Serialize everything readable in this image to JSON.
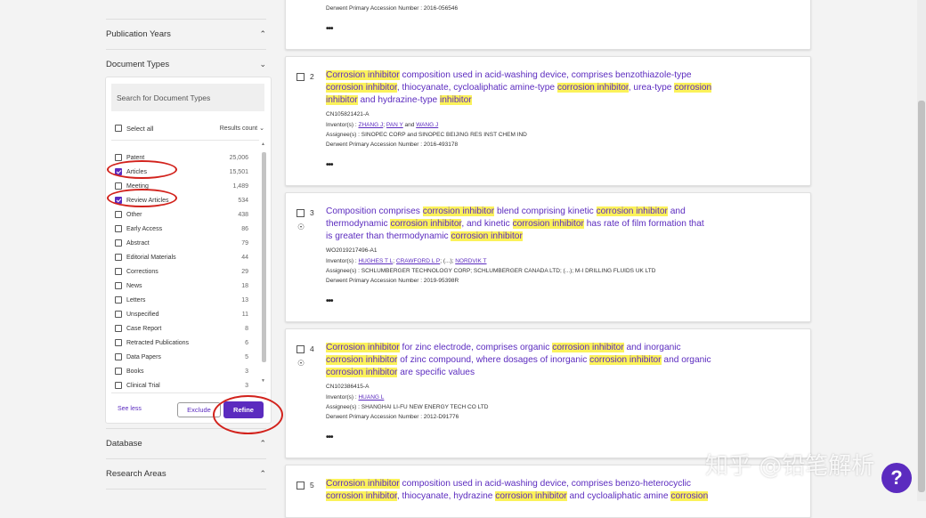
{
  "sidebar": {
    "publication_years": "Publication Years",
    "document_types": "Document Types",
    "database": "Database",
    "research_areas": "Research Areas",
    "search_placeholder": "Search for Document Types",
    "select_all": "Select all",
    "results_count": "Results count",
    "items": [
      {
        "label": "Patent",
        "count": "25,006",
        "checked": false
      },
      {
        "label": "Articles",
        "count": "15,501",
        "checked": true
      },
      {
        "label": "Meeting",
        "count": "1,489",
        "checked": false
      },
      {
        "label": "Review Articles",
        "count": "534",
        "checked": true
      },
      {
        "label": "Other",
        "count": "438",
        "checked": false
      },
      {
        "label": "Early Access",
        "count": "86",
        "checked": false
      },
      {
        "label": "Abstract",
        "count": "79",
        "checked": false
      },
      {
        "label": "Editorial Materials",
        "count": "44",
        "checked": false
      },
      {
        "label": "Corrections",
        "count": "29",
        "checked": false
      },
      {
        "label": "News",
        "count": "18",
        "checked": false
      },
      {
        "label": "Letters",
        "count": "13",
        "checked": false
      },
      {
        "label": "Unspecified",
        "count": "11",
        "checked": false
      },
      {
        "label": "Case Report",
        "count": "8",
        "checked": false
      },
      {
        "label": "Retracted Publications",
        "count": "6",
        "checked": false
      },
      {
        "label": "Data Papers",
        "count": "5",
        "checked": false
      },
      {
        "label": "Books",
        "count": "3",
        "checked": false
      },
      {
        "label": "Clinical Trial",
        "count": "3",
        "checked": false
      }
    ],
    "see_less": "See less",
    "exclude": "Exclude",
    "refine": "Refine"
  },
  "records": {
    "prev_accession": "Derwent Primary Accession Number : 2016-056546",
    "more": "•••",
    "r2": {
      "num": "2",
      "id": "CN105821421-A",
      "inventors_label": "Inventor(s) : ",
      "inventor_a": "ZHANG J",
      "inventor_b": "PAN Y",
      "inventor_and": " and ",
      "inventor_c": "WANG J",
      "assignee": "Assignee(s) : SINOPEC CORP and SINOPEC BEIJING RES INST CHEM IND",
      "accession": "Derwent Primary Accession Number : 2016-493178"
    },
    "r3": {
      "num": "3",
      "id": "WO2019217496-A1",
      "inventors_label": "Inventor(s) : ",
      "inventor_a": "HUGHES T L",
      "inventor_b": "CRAWFORD L P",
      "inventor_etc": " (...); ",
      "inventor_c": "NORDVIK T",
      "assignee": "Assignee(s) : SCHLUMBERGER TECHNOLOGY CORP; SCHLUMBERGER CANADA LTD; (...); M-I DRILLING FLUIDS UK LTD",
      "accession": "Derwent Primary Accession Number : 2019-95398R"
    },
    "r4": {
      "num": "4",
      "id": "CN102386415-A",
      "inventors_label": "Inventor(s) : ",
      "inventor_a": "HUANG L",
      "assignee": "Assignee(s) : SHANGHAI LI-FU NEW ENERGY TECH CO LTD",
      "accession": "Derwent Primary Accession Number : 2012-D91776"
    },
    "r5": {
      "num": "5"
    },
    "titles": {
      "t2": [
        [
          "Corrosion inhibitor",
          true
        ],
        [
          " composition used in acid-washing device, comprises benzothiazole-type",
          false
        ],
        [
          "\n",
          false
        ],
        [
          "corrosion inhibitor",
          true
        ],
        [
          ", thiocyanate, cycloaliphatic amine-type ",
          false
        ],
        [
          "corrosion inhibitor",
          true
        ],
        [
          ", urea-type ",
          false
        ],
        [
          "corrosion",
          true
        ],
        [
          "\n",
          false
        ],
        [
          "inhibitor",
          true
        ],
        [
          " and hydrazine-type ",
          false
        ],
        [
          "inhibitor",
          true
        ]
      ],
      "t3": [
        [
          "Composition comprises ",
          false
        ],
        [
          "corrosion inhibitor",
          true
        ],
        [
          " blend comprising kinetic ",
          false
        ],
        [
          "corrosion inhibitor",
          true
        ],
        [
          " and",
          false
        ],
        [
          "\n",
          false
        ],
        [
          "thermodynamic ",
          false
        ],
        [
          "corrosion inhibitor",
          true
        ],
        [
          ", and kinetic ",
          false
        ],
        [
          "corrosion inhibitor",
          true
        ],
        [
          " has rate of film formation that",
          false
        ],
        [
          "\n",
          false
        ],
        [
          "is greater than thermodynamic ",
          false
        ],
        [
          "corrosion inhibitor",
          true
        ]
      ],
      "t4": [
        [
          "Corrosion inhibitor",
          true
        ],
        [
          " for zinc electrode, comprises organic ",
          false
        ],
        [
          "corrosion inhibitor",
          true
        ],
        [
          " and inorganic",
          false
        ],
        [
          "\n",
          false
        ],
        [
          "corrosion inhibitor",
          true
        ],
        [
          " of zinc compound, where dosages of inorganic ",
          false
        ],
        [
          "corrosion inhibitor",
          true
        ],
        [
          " and organic",
          false
        ],
        [
          "\n",
          false
        ],
        [
          "corrosion inhibitor",
          true
        ],
        [
          " are specific values",
          false
        ]
      ],
      "t5": [
        [
          "Corrosion inhibitor",
          true
        ],
        [
          " composition used in acid-washing device, comprises benzo-heterocyclic",
          false
        ],
        [
          "\n",
          false
        ],
        [
          "corrosion inhibitor",
          true
        ],
        [
          ", thiocyanate, hydrazine ",
          false
        ],
        [
          "corrosion inhibitor",
          true
        ],
        [
          " and cycloaliphatic amine ",
          false
        ],
        [
          "corrosion",
          true
        ]
      ]
    }
  },
  "watermark": "知乎 @铅笔解析",
  "help_icon_glyph": "?",
  "colors": {
    "accent": "#5b2bbf",
    "highlight": "#fbf25a",
    "annotation": "#d2221c"
  }
}
